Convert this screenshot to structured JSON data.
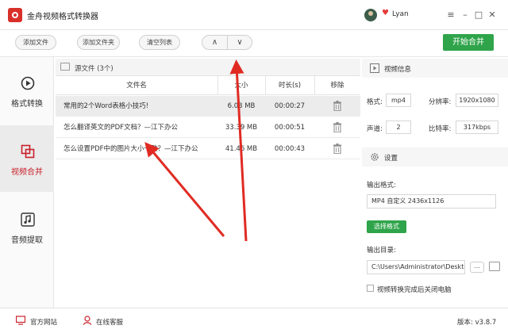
{
  "app": {
    "title": "金舟视频格式转换器"
  },
  "user": {
    "name": "Lyan"
  },
  "toolbar": {
    "add_file": "添加文件",
    "add_folder": "添加文件夹",
    "clear_list": "清空列表",
    "move_up": "∧",
    "move_down": "∨",
    "start_merge": "开始合并"
  },
  "sidebar": {
    "items": [
      {
        "label": "格式转换"
      },
      {
        "label": "视频合并"
      },
      {
        "label": "音频提取"
      }
    ]
  },
  "file_list": {
    "title": "源文件 (3个)",
    "columns": [
      "文件名",
      "大小",
      "时长(s)",
      "移除"
    ],
    "rows": [
      {
        "name": "常用的2个Word表格小技巧!",
        "size": "6.03 MB",
        "duration": "00:00:27"
      },
      {
        "name": "怎么翻译英文的PDF文档？—江下办公",
        "size": "33.39 MB",
        "duration": "00:00:51"
      },
      {
        "name": "怎么设置PDF中的图片大小一致？—江下办公",
        "size": "41.46 MB",
        "duration": "00:00:43"
      }
    ]
  },
  "video_info": {
    "title": "视频信息",
    "format_label": "格式:",
    "format_value": "mp4",
    "resolution_label": "分辨率:",
    "resolution_value": "1920x1080",
    "channels_label": "声道:",
    "channels_value": "2",
    "bitrate_label": "比特率:",
    "bitrate_value": "317kbps"
  },
  "settings": {
    "title": "设置",
    "output_format_label": "输出格式:",
    "output_format_value": "MP4 自定义 2436x1126",
    "choose_format": "选择格式",
    "output_dir_label": "输出目录:",
    "output_dir_value": "C:\\Users\\Administrator\\Deskto",
    "dir_more": "...",
    "shutdown_label": "视频转换完成后关闭电脑"
  },
  "footer": {
    "website": "官方网站",
    "support": "在线客服",
    "version": "版本: v3.8.7"
  },
  "colors": {
    "accent_green": "#2fa44a",
    "accent_red": "#c8202a",
    "annotation_arrow": "#e02b23"
  }
}
